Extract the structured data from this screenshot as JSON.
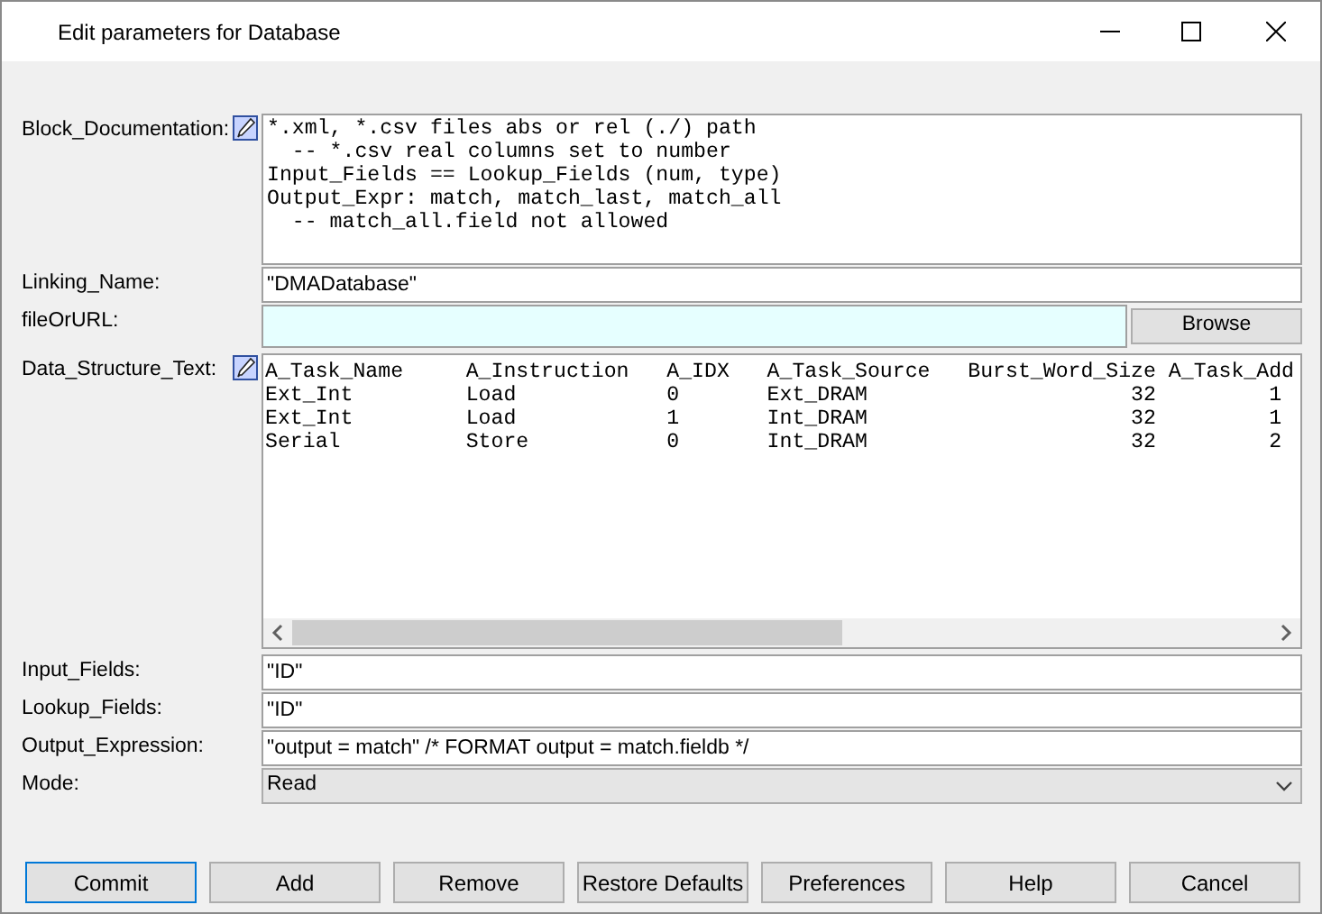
{
  "window": {
    "title": "Edit parameters for Database"
  },
  "fields": [
    {
      "kind": "textarea",
      "label": "Block_Documentation:",
      "editable_icon": true,
      "lines": [
        "*.xml, *.csv files abs or rel (./) path",
        "  -- *.csv real columns set to number",
        "Input_Fields == Lookup_Fields (num, type)",
        "Output_Expr: match, match_last, match_all",
        "  -- match_all.field not allowed"
      ]
    },
    {
      "kind": "text",
      "label": "Linking_Name:",
      "value": "\"DMADatabase\""
    },
    {
      "kind": "file",
      "label": "fileOrURL:",
      "button": "Browse"
    },
    {
      "kind": "table_text",
      "label": "Data_Structure_Text:",
      "editable_icon": true,
      "lines": [
        "A_Task_Name     A_Instruction   A_IDX   A_Task_Source   Burst_Word_Size A_Task_Add",
        "Ext_Int         Load            0       Ext_DRAM                     32         1",
        "Ext_Int         Load            1       Int_DRAM                     32         1",
        "Serial          Store           0       Int_DRAM                     32         2"
      ]
    },
    {
      "kind": "text",
      "label": "Input_Fields:",
      "value": "\"ID\""
    },
    {
      "kind": "text",
      "label": "Lookup_Fields:",
      "value": "\"ID\""
    },
    {
      "kind": "text",
      "label": "Output_Expression:",
      "value": "\"output = match\" /* FORMAT output = match.fieldb */"
    },
    {
      "kind": "select",
      "label": "Mode:",
      "value": "Read"
    }
  ],
  "buttons": [
    {
      "label": "Commit",
      "selected": true
    },
    {
      "label": "Add",
      "selected": false
    },
    {
      "label": "Remove",
      "selected": false
    },
    {
      "label": "Restore Defaults",
      "selected": false
    },
    {
      "label": "Preferences",
      "selected": false
    },
    {
      "label": "Help",
      "selected": false
    },
    {
      "label": "Cancel",
      "selected": false
    }
  ]
}
